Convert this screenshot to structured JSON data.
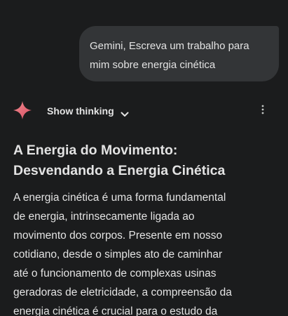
{
  "user_message": {
    "text": "Gemini, Escreva um trabalho para\nmim sobre energia cinética"
  },
  "thinking": {
    "label": "Show thinking",
    "brand_color": "#e8616f"
  },
  "icons": {
    "logo": "gemini-spark-icon",
    "toggle": "chevron-down-icon",
    "menu": "more-vertical-icon"
  },
  "response": {
    "title": "A Energia do Movimento:\nDesvendando a Energia Cinética",
    "body": "A energia cinética é uma forma fundamental\nde energia, intrinsecamente ligada ao\nmovimento dos corpos. Presente em nosso\ncotidiano, desde o simples ato de caminhar\naté o funcionamento de complexas usinas\ngeradoras de eletricidade, a compreensão da\nenergia cinética é crucial para o estudo da"
  }
}
